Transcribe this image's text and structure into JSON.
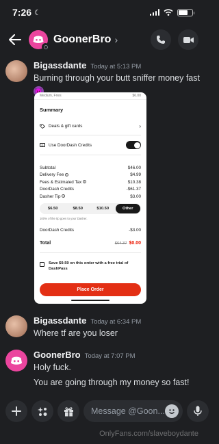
{
  "status_bar": {
    "time": "7:26",
    "icons": [
      "moon-icon",
      "signal-icon",
      "wifi-icon",
      "battery-icon"
    ]
  },
  "header": {
    "title": "GoonerBro",
    "icons": [
      "back-arrow-icon",
      "call-icon",
      "video-icon"
    ]
  },
  "messages": [
    {
      "author": "Bigassdante",
      "timestamp": "Today at 5:13 PM",
      "text": "Burning through your butt sniffer money fast",
      "emoji": "devil-emoji-icon"
    },
    {
      "author": "Bigassdante",
      "timestamp": "Today at 6:34 PM",
      "text": "Where tf are you loser"
    },
    {
      "author": "GoonerBro",
      "timestamp": "Today at 7:07 PM",
      "lines": [
        "Holy fuck.",
        "You are going through my money so fast!"
      ]
    }
  ],
  "order": {
    "top_left": "Medium, Fries",
    "top_right": "$6.00",
    "summary_title": "Summary",
    "deals_label": "Deals & gift cards",
    "credits_toggle_label": "Use DoorDash Credits",
    "lines": [
      {
        "label": "Subtotal",
        "value": "$46.00",
        "info": false
      },
      {
        "label": "Delivery Fee",
        "value": "$4.99",
        "info": true
      },
      {
        "label": "Fees & Estimated Tax",
        "value": "$10.38",
        "info": true
      },
      {
        "label": "DoorDash Credits",
        "value": "-$61.37",
        "info": false
      },
      {
        "label": "Dasher Tip",
        "value": "$3.00",
        "info": true
      }
    ],
    "tip_options": [
      "$6.50",
      "$8.50",
      "$10.50",
      "Other"
    ],
    "tip_selected": "Other",
    "tip_note": "100% of the tip goes to your Dasher.",
    "credits_after_label": "DoorDash Credits",
    "credits_after_value": "-$3.00",
    "total_label": "Total",
    "total_original": "$64.37",
    "total_value": "$0.00",
    "dashpass_text": "Save $9.59 on this order with a free trial of DashPass",
    "place_order_label": "Place Order"
  },
  "composer": {
    "placeholder": "Message @Goon...",
    "icons": [
      "plus-icon",
      "apps-icon",
      "gift-icon",
      "emoji-icon",
      "microphone-icon"
    ]
  },
  "watermark": "OnlyFans.com/slaveboydante",
  "colors": {
    "background": "#1e1f22",
    "accent_pink": "#eb459e",
    "doordash_red": "#e32f14"
  }
}
